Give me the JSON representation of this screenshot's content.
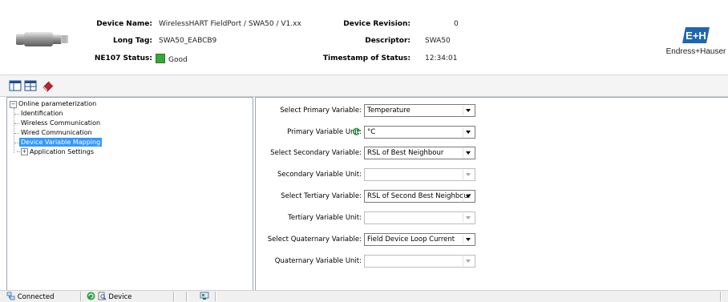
{
  "header": {
    "device_name_label": "Device Name:",
    "device_name_value": "WirelessHART FieldPort / SWA50 / V1.xx",
    "long_tag_label": "Long Tag:",
    "long_tag_value": "SWA50_EABCB9",
    "ne107_label": "NE107 Status:",
    "ne107_value": "Good",
    "ne107_color": "#3aa53a",
    "device_revision_label": "Device Revision:",
    "device_revision_value": "0",
    "descriptor_label": "Descriptor:",
    "descriptor_value": "SWA50",
    "timestamp_label": "Timestamp of Status:",
    "timestamp_value": "12:34:01",
    "logo_text": "Endress+Hauser",
    "brand_color": "#1f66b2"
  },
  "toolbar": {
    "buttons": [
      "layout-icon",
      "window-icon",
      "book-icon"
    ]
  },
  "tree": {
    "root": "Online parameterization",
    "items": [
      "Identification",
      "Wireless Communication",
      "Wired Communication",
      "Device Variable Mapping"
    ],
    "selected": "Device Variable Mapping",
    "second_root": "Application Settings"
  },
  "form": {
    "rows": [
      {
        "label": "Select Primary Variable:",
        "value": "Temperature",
        "enabled": true
      },
      {
        "label": "Primary Variable Unit:",
        "value": "°C",
        "enabled": true
      },
      {
        "label": "Select Secondary Variable:",
        "value": "RSL of Best Neighbour",
        "enabled": true
      },
      {
        "label": "Secondary Variable Unit:",
        "value": "",
        "enabled": false
      },
      {
        "label": "Select Tertiary Variable:",
        "value": "RSL of Second Best Neighbour",
        "enabled": true
      },
      {
        "label": "Tertiary Variable Unit:",
        "value": "",
        "enabled": false
      },
      {
        "label": "Select Quaternary Variable:",
        "value": "Field Device Loop Current",
        "enabled": true
      },
      {
        "label": "Quaternary Variable Unit:",
        "value": "",
        "enabled": false
      }
    ]
  },
  "statusbar": {
    "connection": "Connected",
    "mode": "Device"
  }
}
